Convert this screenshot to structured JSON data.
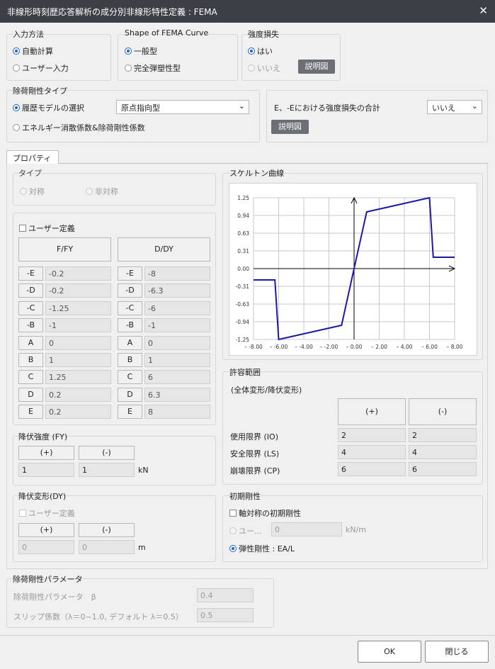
{
  "title": "非線形時刻歴応答解析の成分別非線形特性定義 : FEMA",
  "input_method": {
    "title": "入力方法",
    "auto": "自動計算",
    "user": "ユーザー入力"
  },
  "fema_shape": {
    "title": "Shape of FEMA Curve",
    "general": "一般型",
    "perfect": "完全弾塑性型"
  },
  "strength_loss": {
    "title": "強度損失",
    "yes": "はい",
    "no": "いいえ",
    "diagram": "説明図"
  },
  "unloading": {
    "title": "除荷剛性タイプ",
    "hysteresis": "履歴モデルの選択",
    "hysteresis_value": "原点指向型",
    "energy": "エネルギー消散係数&除荷剛性係数",
    "sum_label": "E、-Eにおける強度損失の合計",
    "sum_value": "いいえ",
    "diagram": "説明図"
  },
  "tab_properties": "プロパティ",
  "type_group": {
    "title": "タイプ",
    "sym": "対称",
    "asym": "非対称"
  },
  "user_def": {
    "label": "ユーザー定義",
    "h1": "F/FY",
    "h2": "D/DY",
    "rows": [
      {
        "k1": "-E",
        "v1": "-0.2",
        "k2": "-E",
        "v2": "-8"
      },
      {
        "k1": "-D",
        "v1": "-0.2",
        "k2": "-D",
        "v2": "-6.3"
      },
      {
        "k1": "-C",
        "v1": "-1.25",
        "k2": "-C",
        "v2": "-6"
      },
      {
        "k1": "-B",
        "v1": "-1",
        "k2": "-B",
        "v2": "-1"
      },
      {
        "k1": "A",
        "v1": "0",
        "k2": "A",
        "v2": "0"
      },
      {
        "k1": "B",
        "v1": "1",
        "k2": "B",
        "v2": "1"
      },
      {
        "k1": "C",
        "v1": "1.25",
        "k2": "C",
        "v2": "6"
      },
      {
        "k1": "D",
        "v1": "0.2",
        "k2": "D",
        "v2": "6.3"
      },
      {
        "k1": "E",
        "v1": "0.2",
        "k2": "E",
        "v2": "8"
      }
    ]
  },
  "yield_strength": {
    "title": "降伏強度 (FY)",
    "plus": "(+)",
    "minus": "(-)",
    "v_plus": "1",
    "v_minus": "1",
    "unit": "kN"
  },
  "yield_deform": {
    "title": "降伏変形(DY)",
    "user": "ユーザー定義",
    "plus": "(+)",
    "minus": "(-)",
    "v_plus": "0",
    "v_minus": "0",
    "unit": "m"
  },
  "skeleton": {
    "title": "スケルトン曲線",
    "y_ticks": [
      "1.25",
      "0.94",
      "0.63",
      "0.31",
      "0.00",
      "-0.31",
      "-0.63",
      "-0.94",
      "-1.25"
    ],
    "x_ticks": [
      "-8.00",
      "-6.00",
      "-4.00",
      "-2.00",
      "0.00",
      "2.00",
      "4.00",
      "6.00",
      "8.00"
    ]
  },
  "chart_data": {
    "type": "line",
    "title": "スケルトン曲線",
    "xlabel": "",
    "ylabel": "",
    "xlim": [
      -8,
      8
    ],
    "ylim": [
      -1.25,
      1.25
    ],
    "grid": true,
    "series": [
      {
        "x": [
          -8,
          -6.3,
          -6,
          -1,
          0,
          1,
          6,
          6.3,
          8
        ],
        "y": [
          -0.2,
          -0.2,
          -1.25,
          -1,
          0,
          1,
          1.25,
          0.2,
          0.2
        ],
        "color": "#1a1aa6"
      }
    ]
  },
  "acceptance": {
    "title": "許容範囲",
    "subtitle": "(全体変形/降伏変形)",
    "plus": "(+)",
    "minus": "(-)",
    "rows": [
      {
        "label": "使用限界 (IO)",
        "p": "2",
        "m": "2"
      },
      {
        "label": "安全限界 (LS)",
        "p": "4",
        "m": "4"
      },
      {
        "label": "崩壊限界 (CP)",
        "p": "6",
        "m": "6"
      }
    ]
  },
  "initial_stiffness": {
    "title": "初期剛性",
    "axisym": "軸対称の初期剛性",
    "user": "ユー...",
    "user_value": "0",
    "unit": "kN/m",
    "elastic": "弾性剛性 : EA/L"
  },
  "unload_param": {
    "title": "除荷剛性パラメータ",
    "beta_label": "除荷剛性パラメータ　β",
    "beta_value": "0.4",
    "slip_label": "スリップ係数（λ＝0~1.0, デフォルト λ＝0.5）",
    "slip_value": "0.5"
  },
  "footer": {
    "ok": "OK",
    "close": "閉じる"
  }
}
